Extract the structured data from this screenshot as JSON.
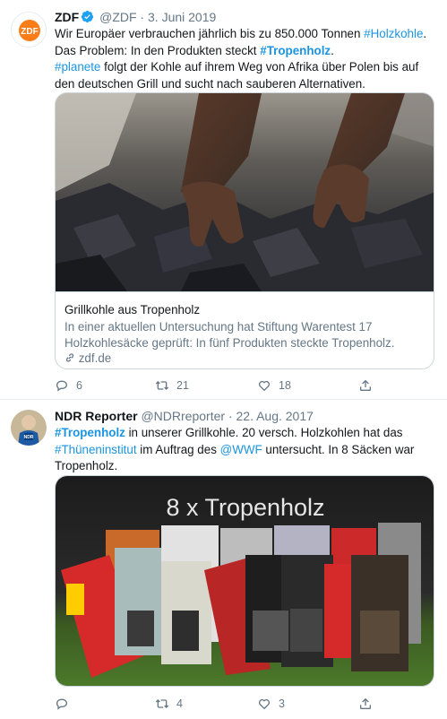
{
  "tweets": [
    {
      "author": {
        "name": "ZDF",
        "handle": "@ZDF",
        "date": "3. Juni 2019",
        "verified": true,
        "avatar_text": "ZDF"
      },
      "text_segments": {
        "s1": "Wir Europäer verbrauchen jährlich bis zu 850.000 Tonnen ",
        "tag1": "#Holzkohle",
        "s2": ".",
        "s3": "Das Problem: In den Produkten steckt ",
        "tag2": "#Tropenholz",
        "s4": ".",
        "tag3": "#planete",
        "s5": " folgt der Kohle auf ihrem Weg von Afrika über Polen bis auf",
        "s6": "den deutschen Grill und sucht nach sauberen Alternativen."
      },
      "card": {
        "title": "Grillkohle aus Tropenholz",
        "description_line1": "In einer aktuellen Untersuchung hat Stiftung Warentest 17",
        "description_line2": "Holzkohlesäcke geprüft: In fünf Produkten steckte Tropenholz.",
        "link": "zdf.de"
      },
      "actions": {
        "reply": "6",
        "retweet": "21",
        "like": "18"
      }
    },
    {
      "author": {
        "name": "NDR Reporter",
        "handle": "@NDRreporter",
        "date": "22. Aug. 2017",
        "verified": false,
        "avatar_text": "NDR"
      },
      "text_segments": {
        "tag1": "#Tropenholz",
        "s1": " in unserer Grillkohle. 20 versch. Holzkohlen hat das",
        "tag2": "#Thüneninstitut",
        "s2": " im Auftrag des ",
        "tag3": "@WWF",
        "s3": " untersucht. In 8 Säcken war",
        "s4": "Tropenholz."
      },
      "media": {
        "overlay_text": "8 x Tropenholz"
      },
      "actions": {
        "reply": "",
        "retweet": "4",
        "like": "3"
      }
    }
  ],
  "colors": {
    "link": "#1b95e0",
    "secondary_text": "#657786",
    "border": "#e6ecf0",
    "zdf_orange": "#fa7d19",
    "verified_blue": "#1da1f2"
  }
}
